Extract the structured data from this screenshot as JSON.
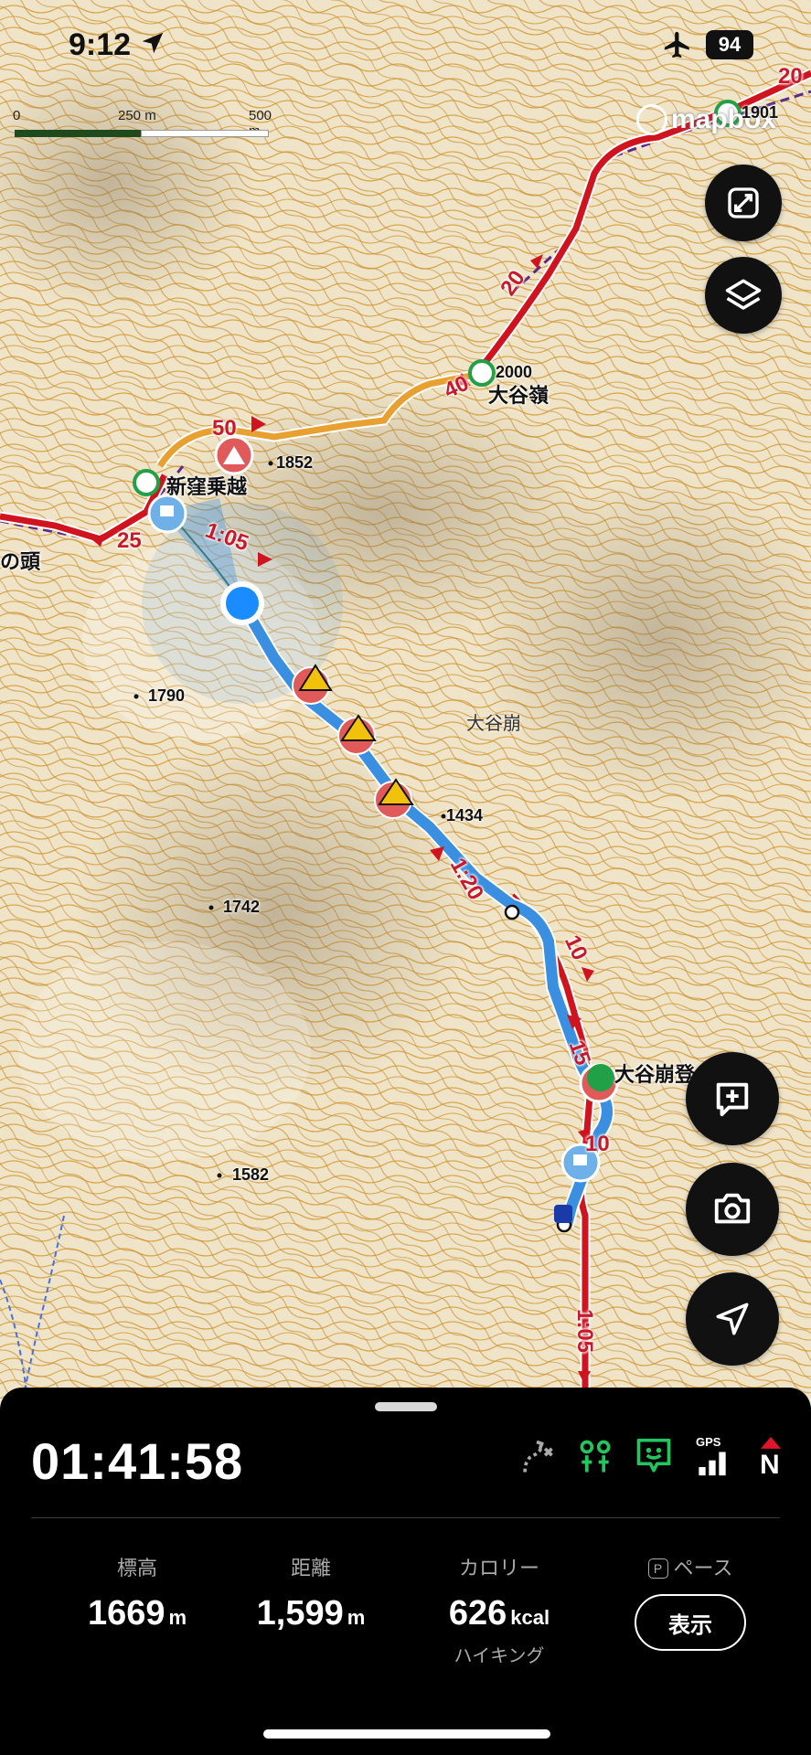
{
  "status_bar": {
    "time": "9:12",
    "battery": "94"
  },
  "map": {
    "scale": {
      "zero": "0",
      "mid": "250 m",
      "max": "500 m"
    },
    "brand": "mapbox",
    "places": {
      "shinkubo": "新窪乗越",
      "otanire": "大谷嶺",
      "otanikuzure": "大谷崩",
      "otanikuzure_trailhead": "大谷崩登",
      "atama": "の頭"
    },
    "elevations": {
      "p1852": "1852",
      "p2000": "2000",
      "p1901": "1901",
      "p1790": "1790",
      "p1434": "1434",
      "p1742": "1742",
      "p1582": "1582"
    },
    "route_times": {
      "t50": "50",
      "t40": "40",
      "t20": "20",
      "t25": "25",
      "t105a": "1:05",
      "t120": "1:20",
      "t10a": "10",
      "t15": "15",
      "t10b": "10",
      "t105b": "1:05",
      "t20top": "20"
    }
  },
  "panel": {
    "elapsed": "01:41:58",
    "gps_label": "GPS",
    "compass_label": "N",
    "stats": [
      {
        "label": "標高",
        "value": "1669",
        "unit": "m"
      },
      {
        "label": "距離",
        "value": "1,599",
        "unit": "m"
      },
      {
        "label": "カロリー",
        "value": "626",
        "unit": "kcal",
        "sub": "ハイキング"
      },
      {
        "label": "ペース",
        "badge": "P"
      }
    ],
    "show_button": "表示"
  },
  "colors": {
    "route_red": "#d0141f",
    "track_blue": "#3a8fe0",
    "trail_orange": "#e8a030",
    "accent_green": "#22a048",
    "current_location": "#1a8cff"
  }
}
